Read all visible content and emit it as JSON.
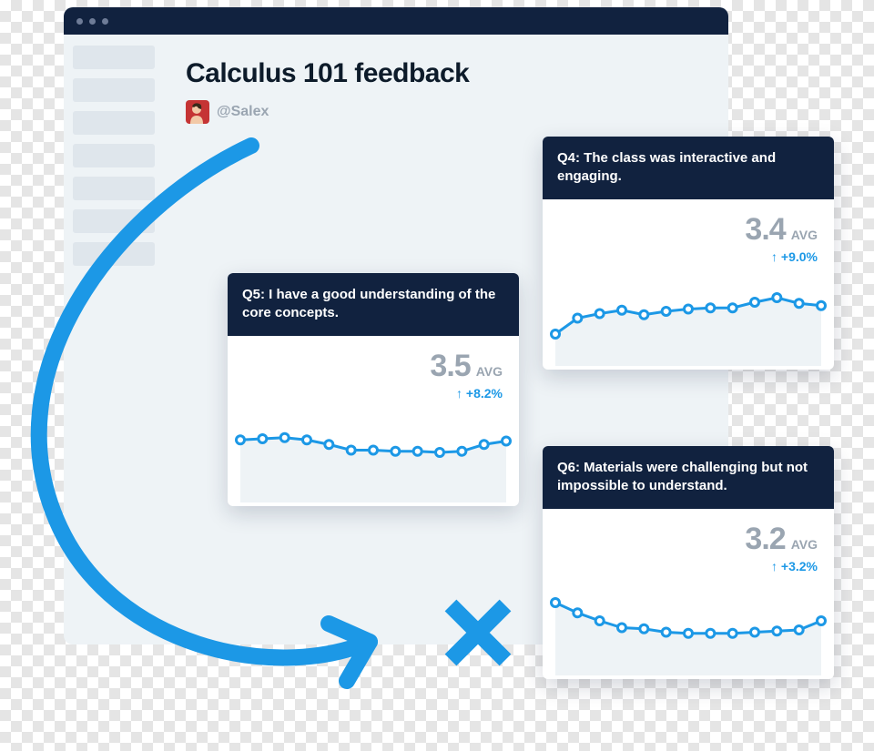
{
  "page": {
    "title": "Calculus 101 feedback",
    "author_handle": "@Salex"
  },
  "cards": {
    "q5": {
      "title": "Q5:   I have a good understanding of the core concepts.",
      "avg": "3.5",
      "avg_label": "AVG",
      "delta": "↑ +8.2%"
    },
    "q4": {
      "title": "Q4: The class was interactive and engaging.",
      "avg": "3.4",
      "avg_label": "AVG",
      "delta": "↑ +9.0%"
    },
    "q6": {
      "title": "Q6: Materials were challenging but not impossible to understand.",
      "avg": "3.2",
      "avg_label": "AVG",
      "delta": "↑ +3.2%"
    }
  },
  "colors": {
    "blue": "#1c98e6",
    "navy": "#11223f",
    "grey": "#9aa5b1"
  },
  "chart_data": [
    {
      "id": "q5",
      "type": "line",
      "title": "Q5: I have a good understanding of the core concepts.",
      "values": [
        3.75,
        3.8,
        3.85,
        3.75,
        3.55,
        3.3,
        3.3,
        3.25,
        3.25,
        3.2,
        3.25,
        3.55,
        3.7
      ],
      "ylim": [
        1,
        5
      ],
      "avg": 3.5,
      "delta_pct": 8.2
    },
    {
      "id": "q4",
      "type": "line",
      "title": "Q4: The class was interactive and engaging.",
      "values": [
        2.4,
        3.1,
        3.3,
        3.45,
        3.25,
        3.4,
        3.5,
        3.55,
        3.55,
        3.8,
        4.0,
        3.75,
        3.65
      ],
      "ylim": [
        1,
        5
      ],
      "avg": 3.4,
      "delta_pct": 9.0
    },
    {
      "id": "q6",
      "type": "line",
      "title": "Q6: Materials were challenging but not impossible to understand.",
      "values": [
        4.2,
        3.75,
        3.4,
        3.1,
        3.05,
        2.9,
        2.85,
        2.85,
        2.85,
        2.9,
        2.95,
        3.0,
        3.4
      ],
      "ylim": [
        1,
        5
      ],
      "avg": 3.2,
      "delta_pct": 3.2
    }
  ]
}
